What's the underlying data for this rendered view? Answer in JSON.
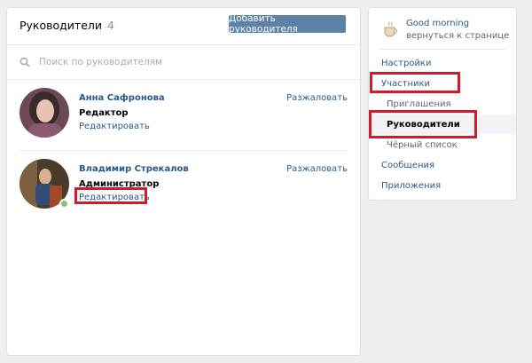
{
  "main": {
    "title": "Руководители",
    "count": "4",
    "add_button": "Добавить руководителя",
    "search_placeholder": "Поиск по руководителям"
  },
  "members": [
    {
      "name": "Анна Сафронова",
      "role": "Редактор",
      "edit": "Редактировать",
      "demote": "Разжаловать",
      "online": false
    },
    {
      "name": "Владимир Стрекалов",
      "role": "Администратор",
      "edit": "Редактировать",
      "demote": "Разжаловать",
      "online": true
    }
  ],
  "sidebar": {
    "group_name": "Good morning",
    "back_link": "вернуться к странице",
    "items": [
      {
        "label": "Настройки"
      },
      {
        "label": "Участники"
      },
      {
        "label": "Приглашения"
      },
      {
        "label": "Руководители"
      },
      {
        "label": "Чёрный список"
      },
      {
        "label": "Сообщения"
      },
      {
        "label": "Приложения"
      }
    ]
  },
  "colors": {
    "link": "#2a5885",
    "accent_button": "#5e81a8",
    "highlight": "#d01b2a",
    "background": "#edeef0"
  }
}
